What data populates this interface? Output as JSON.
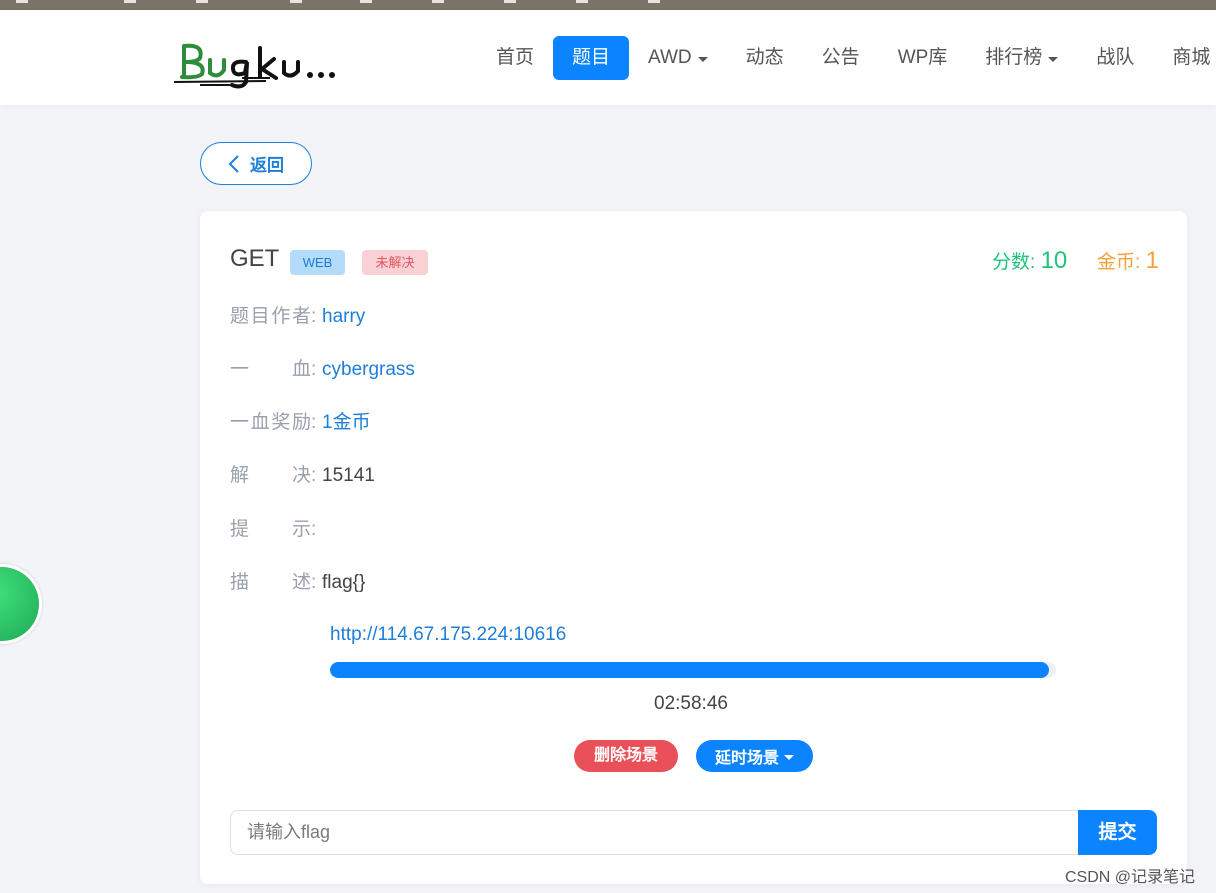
{
  "header": {
    "logo_text": "Bugku...",
    "nav": [
      {
        "label": "首页",
        "active": false,
        "dropdown": false
      },
      {
        "label": "题目",
        "active": true,
        "dropdown": false
      },
      {
        "label": "AWD",
        "active": false,
        "dropdown": true
      },
      {
        "label": "动态",
        "active": false,
        "dropdown": false
      },
      {
        "label": "公告",
        "active": false,
        "dropdown": false
      },
      {
        "label": "WP库",
        "active": false,
        "dropdown": false
      },
      {
        "label": "排行榜",
        "active": false,
        "dropdown": true
      },
      {
        "label": "战队",
        "active": false,
        "dropdown": false
      },
      {
        "label": "商城",
        "active": false,
        "dropdown": false
      }
    ]
  },
  "back_button": {
    "label": "返回",
    "icon": "chevron-left-icon"
  },
  "challenge": {
    "title": "GET",
    "category_badge": "WEB",
    "status_badge": "未解决",
    "score_label": "分数:",
    "score_value": "10",
    "coin_label": "金币:",
    "coin_value": "1",
    "info": [
      {
        "label": "题目作者",
        "colon": ":",
        "value": "harry",
        "link": true
      },
      {
        "label": "一血",
        "colon": ":",
        "value": "cybergrass",
        "link": true
      },
      {
        "label": "一血奖励",
        "colon": ":",
        "value": "1金币",
        "link": true
      },
      {
        "label": "解决",
        "colon": ":",
        "value": "15141",
        "link": false
      },
      {
        "label": "提示",
        "colon": ":",
        "value": "",
        "link": false
      },
      {
        "label": "描述",
        "colon": ":",
        "value": "flag{}",
        "link": false
      }
    ],
    "scene_url": "http://114.67.175.224:10616",
    "scene_progress": 0.99,
    "scene_timer": "02:58:46",
    "delete_scene_label": "删除场景",
    "delay_scene_label": "延时场景",
    "flag_placeholder": "请输入flag",
    "submit_label": "提交"
  },
  "watermark": "CSDN @记录笔记",
  "colors": {
    "primary": "#0d84ff",
    "danger": "#e9505a",
    "score_green": "#1fc37a",
    "coin_orange": "#f6a13a",
    "link_blue": "#1e7fd8"
  }
}
